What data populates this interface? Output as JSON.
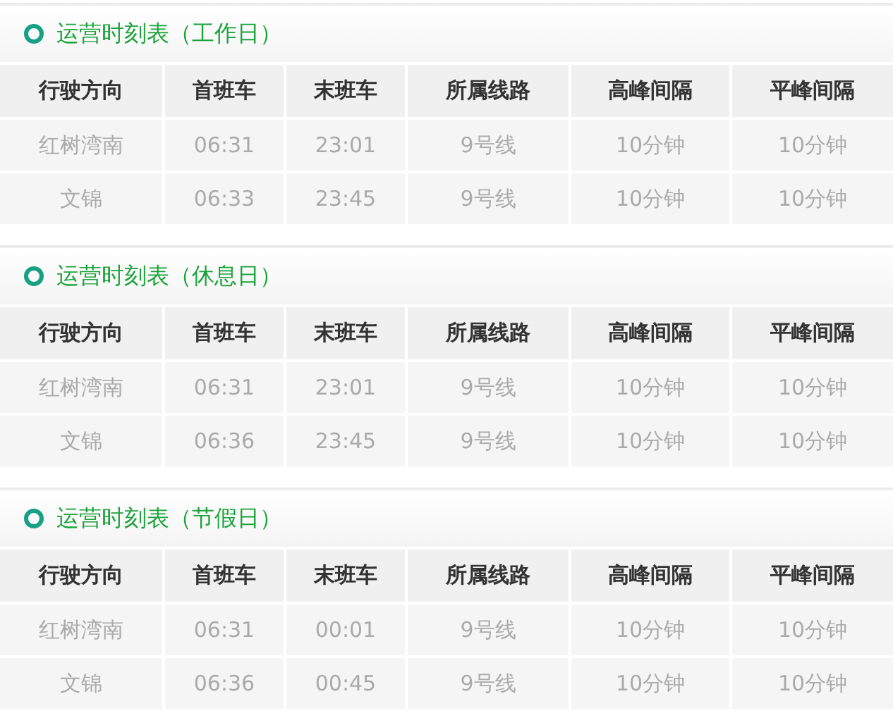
{
  "sections": [
    {
      "title": "运营时刻表（工作日）",
      "columns": [
        "行驶方向",
        "首班车",
        "末班车",
        "所属线路",
        "高峰间隔",
        "平峰间隔"
      ],
      "rows": [
        [
          "红树湾南",
          "06:31",
          "23:01",
          "9号线",
          "10分钟",
          "10分钟"
        ],
        [
          "文锦",
          "06:33",
          "23:45",
          "9号线",
          "10分钟",
          "10分钟"
        ]
      ]
    },
    {
      "title": "运营时刻表（休息日）",
      "columns": [
        "行驶方向",
        "首班车",
        "末班车",
        "所属线路",
        "高峰间隔",
        "平峰间隔"
      ],
      "rows": [
        [
          "红树湾南",
          "06:31",
          "23:01",
          "9号线",
          "10分钟",
          "10分钟"
        ],
        [
          "文锦",
          "06:36",
          "23:45",
          "9号线",
          "10分钟",
          "10分钟"
        ]
      ]
    },
    {
      "title": "运营时刻表（节假日）",
      "columns": [
        "行驶方向",
        "首班车",
        "末班车",
        "所属线路",
        "高峰间隔",
        "平峰间隔"
      ],
      "rows": [
        [
          "红树湾南",
          "06:31",
          "00:01",
          "9号线",
          "10分钟",
          "10分钟"
        ],
        [
          "文锦",
          "06:36",
          "00:45",
          "9号线",
          "10分钟",
          "10分钟"
        ]
      ]
    }
  ]
}
